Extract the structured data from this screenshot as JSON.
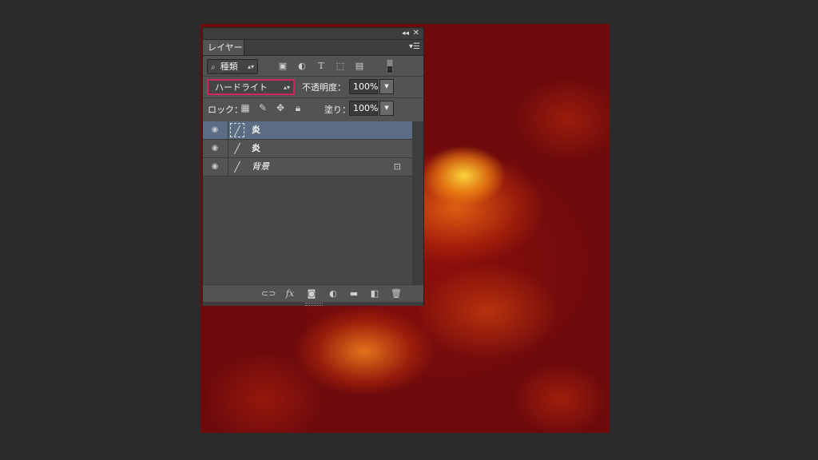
{
  "panel": {
    "collapse_icon": "double-chevron-left-icon",
    "close_icon": "close-icon",
    "tab_label": "レイヤー",
    "menu_icon": "panel-menu-icon"
  },
  "filter": {
    "kind_label": "種類",
    "icons": [
      "image-filter-icon",
      "adjustment-filter-icon",
      "type-filter-icon",
      "shape-filter-icon",
      "smart-object-filter-icon"
    ]
  },
  "blend": {
    "mode": "ハードライト",
    "opacity_label": "不透明度：",
    "opacity_value": "100%"
  },
  "lock": {
    "label": "ロック：",
    "fill_label": "塗り：",
    "fill_value": "100%"
  },
  "layers": [
    {
      "name": "炎",
      "selected": true,
      "visible": true,
      "locked": false
    },
    {
      "name": "炎",
      "selected": false,
      "visible": true,
      "locked": false
    },
    {
      "name": "背景",
      "selected": false,
      "visible": true,
      "locked": true
    }
  ],
  "bottom_icons": [
    "link-layers-icon",
    "fx-icon",
    "layer-mask-icon",
    "adjustment-layer-icon",
    "group-folder-icon",
    "new-layer-icon",
    "trash-icon"
  ],
  "bottom_fx": "fx"
}
